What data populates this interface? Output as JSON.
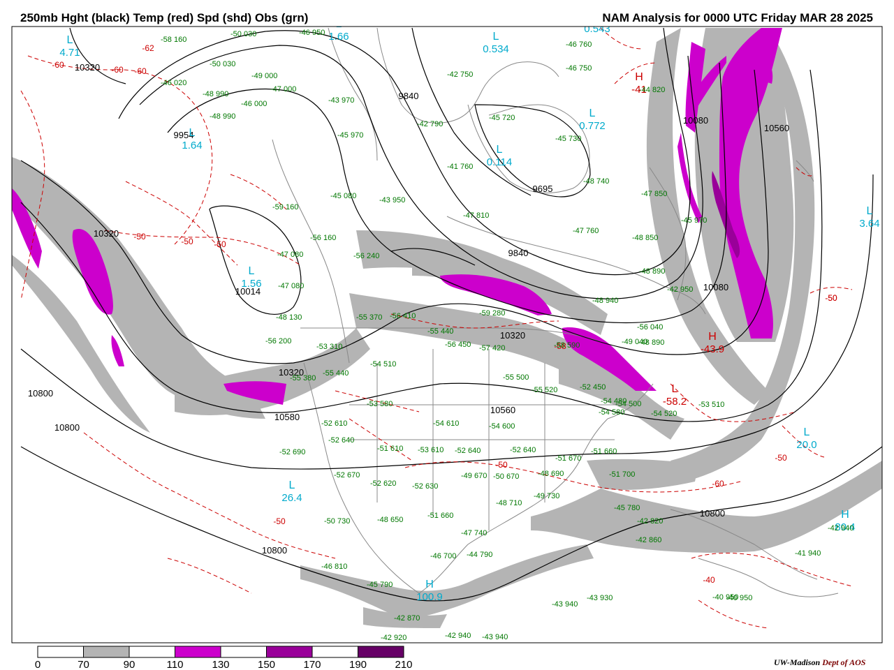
{
  "header": {
    "left_title": "250mb Hght (black) Temp (red) Spd (shd) Obs (grn)",
    "right_title": "NAM Analysis for 0000 UTC Friday  MAR 28 2025"
  },
  "credit": {
    "institution": "UW-Madison",
    "dept": "Dept of AOS"
  },
  "colorbar": {
    "labels": [
      "0",
      "70",
      "90",
      "110",
      "130",
      "150",
      "170",
      "190",
      "210"
    ],
    "colors": [
      "#ffffff",
      "#b4b4b4",
      "#ffffff",
      "#cc00cc",
      "#ffffff",
      "#990099",
      "#ffffff",
      "#660066"
    ]
  },
  "colors": {
    "height": "#000000",
    "temp": "#cc0000",
    "obs": "#007700",
    "low_high_labels": "#00aacc",
    "shade_70_90": "#b4b4b4",
    "shade_110_130": "#cc00cc",
    "shade_150_170": "#990099"
  },
  "height_labels": [
    "10320",
    "9954",
    "9840",
    "9695",
    "10014",
    "9840",
    "10320",
    "10080",
    "10080",
    "10320",
    "10560",
    "10320",
    "10580",
    "10800",
    "10800",
    "10800",
    "10560",
    "10800"
  ],
  "temp_labels": [
    "-62",
    "-60",
    "-60",
    "-60",
    "-50",
    "-50",
    "-50",
    "-50",
    "-50",
    "-60",
    "-50",
    "-50",
    "-40",
    "-58",
    "-50"
  ],
  "pressure_systems": [
    {
      "type": "L",
      "value": "4.71"
    },
    {
      "type": "L",
      "value": "1.64"
    },
    {
      "type": "L",
      "value": "1.66"
    },
    {
      "type": "L",
      "value": "0.534"
    },
    {
      "type": "L",
      "value": "0.543"
    },
    {
      "type": "L",
      "value": "0.772"
    },
    {
      "type": "L",
      "value": "0.114"
    },
    {
      "type": "L",
      "value": "1.56"
    },
    {
      "type": "L",
      "value": "3.64"
    },
    {
      "type": "L",
      "value": "20.0"
    },
    {
      "type": "L",
      "value": "26.4"
    },
    {
      "type": "H",
      "value": "100.9"
    },
    {
      "type": "H",
      "value": "80.4"
    },
    {
      "type": "H",
      "value": "-43.9"
    },
    {
      "type": "H",
      "value": "-41"
    },
    {
      "type": "L",
      "value": "-58.2"
    }
  ],
  "obs": [
    {
      "t": "-58",
      "h": "160"
    },
    {
      "t": "-50",
      "h": "030"
    },
    {
      "t": "-46",
      "h": "950"
    },
    {
      "t": "-50",
      "h": "030"
    },
    {
      "t": "-49",
      "h": "000"
    },
    {
      "t": "-46",
      "h": "020"
    },
    {
      "t": "-47",
      "h": "000"
    },
    {
      "t": "-48",
      "h": "990"
    },
    {
      "t": "-46",
      "h": "000"
    },
    {
      "t": "-48",
      "h": "990"
    },
    {
      "t": "-43",
      "h": "970"
    },
    {
      "t": "-42",
      "h": "790"
    },
    {
      "t": "-42",
      "h": "750"
    },
    {
      "t": "-45",
      "h": "720"
    },
    {
      "t": "-46",
      "h": "760"
    },
    {
      "t": "-46",
      "h": "750"
    },
    {
      "t": "-44",
      "h": "820"
    },
    {
      "t": "-45",
      "h": "970"
    },
    {
      "t": "-41",
      "h": "760"
    },
    {
      "t": "-45",
      "h": "730"
    },
    {
      "t": "-48",
      "h": "740"
    },
    {
      "t": "-47",
      "h": "850"
    },
    {
      "t": "-45",
      "h": "080"
    },
    {
      "t": "-43",
      "h": "950"
    },
    {
      "t": "-47",
      "h": "810"
    },
    {
      "t": "-47",
      "h": "760"
    },
    {
      "t": "-48",
      "h": "850"
    },
    {
      "t": "-45",
      "h": "970"
    },
    {
      "t": "-59",
      "h": "160"
    },
    {
      "t": "-56",
      "h": "160"
    },
    {
      "t": "-47",
      "h": "080"
    },
    {
      "t": "-56",
      "h": "240"
    },
    {
      "t": "-48",
      "h": "890"
    },
    {
      "t": "-47",
      "h": "080"
    },
    {
      "t": "-42",
      "h": "950"
    },
    {
      "t": "-48",
      "h": "940"
    },
    {
      "t": "-48",
      "h": "130"
    },
    {
      "t": "-55",
      "h": "370"
    },
    {
      "t": "-56",
      "h": "410"
    },
    {
      "t": "-59",
      "h": "280"
    },
    {
      "t": "-56",
      "h": "040"
    },
    {
      "t": "-49",
      "h": "040"
    },
    {
      "t": "-56",
      "h": "200"
    },
    {
      "t": "-53",
      "h": "310"
    },
    {
      "t": "-55",
      "h": "440"
    },
    {
      "t": "-56",
      "h": "450"
    },
    {
      "t": "-57",
      "h": "420"
    },
    {
      "t": "-58",
      "h": "590"
    },
    {
      "t": "-48",
      "h": "890"
    },
    {
      "t": "-55",
      "h": "380"
    },
    {
      "t": "-55",
      "h": "440"
    },
    {
      "t": "-54",
      "h": "510"
    },
    {
      "t": "-55",
      "h": "500"
    },
    {
      "t": "-55",
      "h": "520"
    },
    {
      "t": "-52",
      "h": "450"
    },
    {
      "t": "-54",
      "h": "500"
    },
    {
      "t": "-53",
      "h": "580"
    },
    {
      "t": "-54",
      "h": "480"
    },
    {
      "t": "-54",
      "h": "520"
    },
    {
      "t": "-54",
      "h": "580"
    },
    {
      "t": "-53",
      "h": "510"
    },
    {
      "t": "-52",
      "h": "610"
    },
    {
      "t": "-54",
      "h": "610"
    },
    {
      "t": "-54",
      "h": "600"
    },
    {
      "t": "-52",
      "h": "640"
    },
    {
      "t": "-52",
      "h": "690"
    },
    {
      "t": "-51",
      "h": "610"
    },
    {
      "t": "-53",
      "h": "610"
    },
    {
      "t": "-52",
      "h": "640"
    },
    {
      "t": "-52",
      "h": "640"
    },
    {
      "t": "-51",
      "h": "670"
    },
    {
      "t": "-51",
      "h": "660"
    },
    {
      "t": "-52",
      "h": "670"
    },
    {
      "t": "-52",
      "h": "620"
    },
    {
      "t": "-52",
      "h": "630"
    },
    {
      "t": "-49",
      "h": "670"
    },
    {
      "t": "-50",
      "h": "670"
    },
    {
      "t": "-48",
      "h": "690"
    },
    {
      "t": "-51",
      "h": "700"
    },
    {
      "t": "-48",
      "h": "710"
    },
    {
      "t": "-49",
      "h": "730"
    },
    {
      "t": "-45",
      "h": "780"
    },
    {
      "t": "-50",
      "h": "730"
    },
    {
      "t": "-48",
      "h": "650"
    },
    {
      "t": "-51",
      "h": "660"
    },
    {
      "t": "-47",
      "h": "740"
    },
    {
      "t": "-42",
      "h": "820"
    },
    {
      "t": "-42",
      "h": "860"
    },
    {
      "t": "-46",
      "h": "700"
    },
    {
      "t": "-44",
      "h": "790"
    },
    {
      "t": "-41",
      "h": "940"
    },
    {
      "t": "-46",
      "h": "810"
    },
    {
      "t": "-45",
      "h": "790"
    },
    {
      "t": "-43",
      "h": "940"
    },
    {
      "t": "-43",
      "h": "930"
    },
    {
      "t": "-40",
      "h": "950"
    },
    {
      "t": "-42",
      "h": "870"
    },
    {
      "t": "-42",
      "h": "940"
    },
    {
      "t": "-43",
      "h": "940"
    },
    {
      "t": "-42",
      "h": "920"
    },
    {
      "t": "-42",
      "h": "940"
    },
    {
      "t": "-40",
      "h": "950"
    }
  ]
}
